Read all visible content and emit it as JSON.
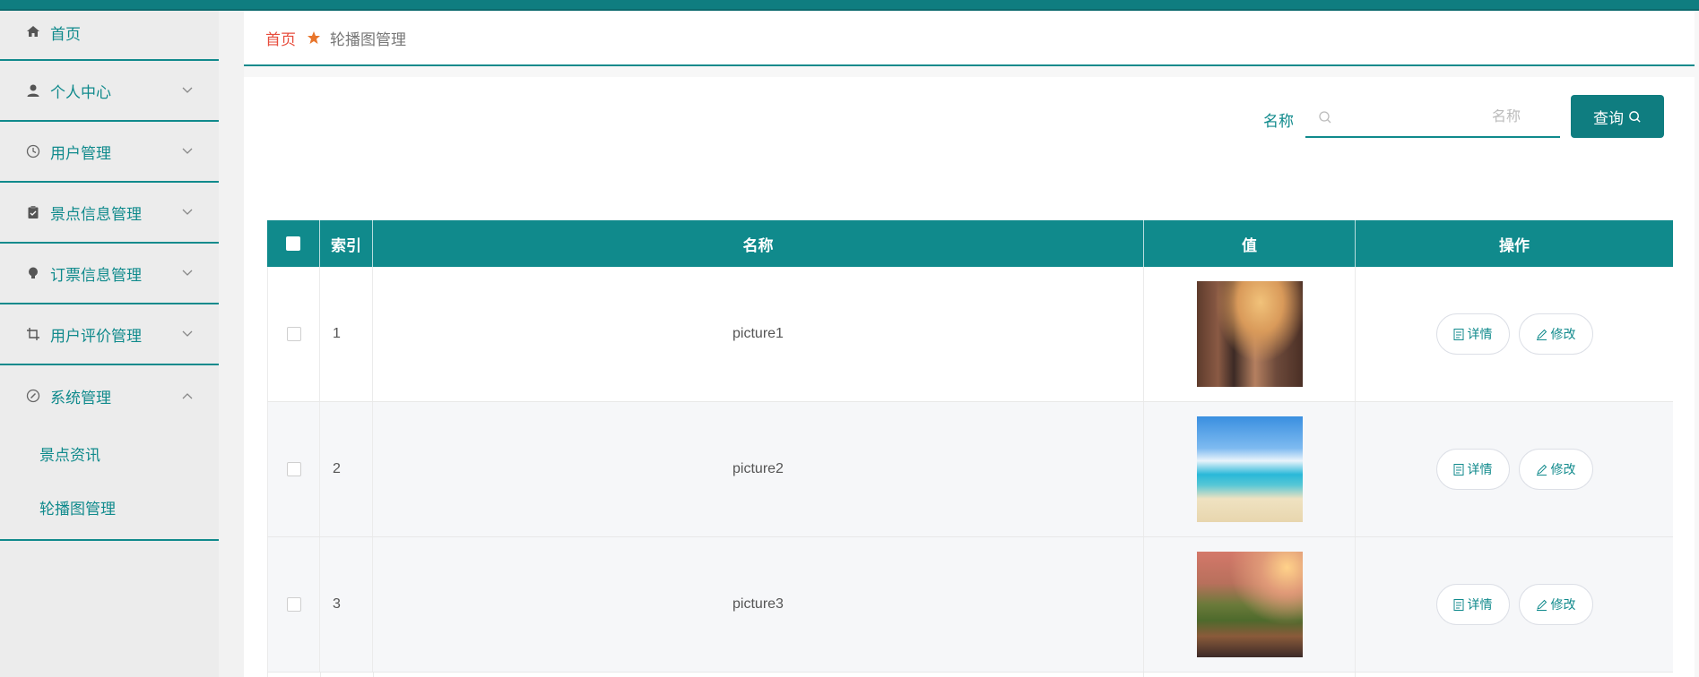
{
  "sidebar": {
    "items": [
      {
        "label": "首页",
        "icon": "home-icon"
      },
      {
        "label": "个人中心",
        "icon": "user-icon"
      },
      {
        "label": "用户管理",
        "icon": "clock-icon"
      },
      {
        "label": "景点信息管理",
        "icon": "clipboard-icon"
      },
      {
        "label": "订票信息管理",
        "icon": "bulb-icon"
      },
      {
        "label": "用户评价管理",
        "icon": "crop-icon"
      },
      {
        "label": "系统管理",
        "icon": "compass-icon"
      }
    ],
    "submenu": [
      {
        "label": "景点资讯"
      },
      {
        "label": "轮播图管理"
      }
    ]
  },
  "breadcrumb": {
    "home": "首页",
    "current": "轮播图管理"
  },
  "search": {
    "label": "名称",
    "placeholder": "名称",
    "button": "查询"
  },
  "table": {
    "headers": {
      "index": "索引",
      "name": "名称",
      "value": "值",
      "ops": "操作"
    },
    "rows": [
      {
        "index": "1",
        "name": "picture1",
        "detail": "详情",
        "edit": "修改"
      },
      {
        "index": "2",
        "name": "picture2",
        "detail": "详情",
        "edit": "修改"
      },
      {
        "index": "3",
        "name": "picture3",
        "detail": "详情",
        "edit": "修改"
      }
    ]
  },
  "colors": {
    "accent": "#108a8c",
    "topbar": "#0f7d80",
    "home_link": "#e74c3c"
  }
}
